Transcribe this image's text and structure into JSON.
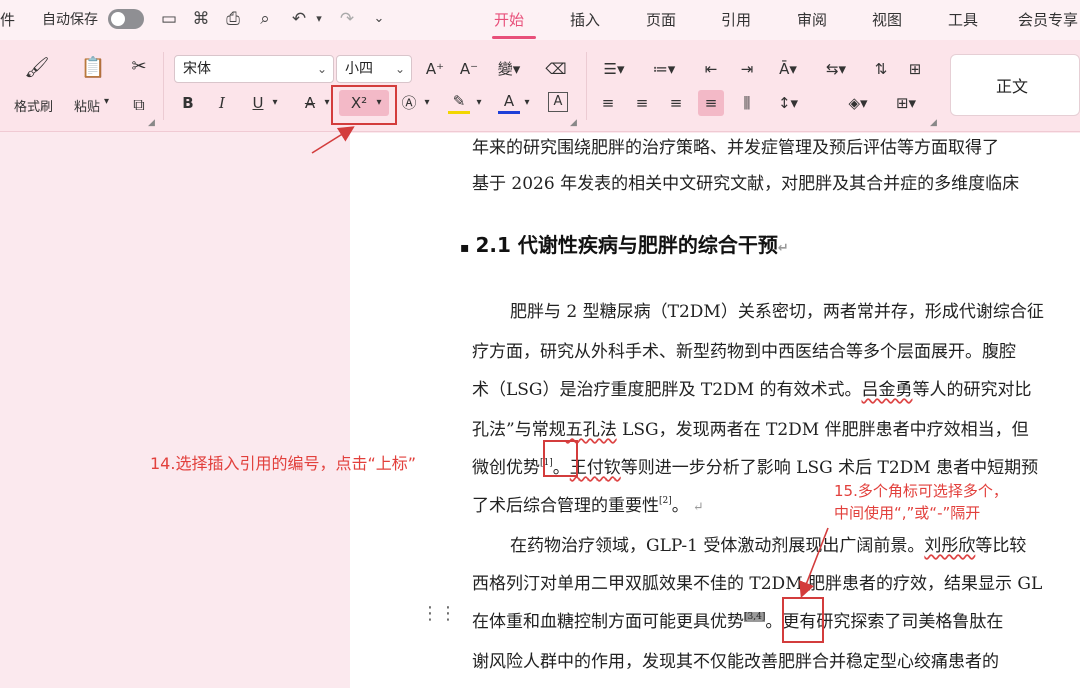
{
  "titlebar": {
    "left_fragment": "件",
    "autosave_label": "自动保存",
    "autosave_on": false
  },
  "menu": {
    "tabs": [
      "开始",
      "插入",
      "页面",
      "引用",
      "审阅",
      "视图",
      "工具",
      "会员专享"
    ],
    "active": "开始"
  },
  "ribbon": {
    "format_painter": "格式刷",
    "paste": "粘贴",
    "font_family": "宋体",
    "font_size": "小四",
    "bold": "B",
    "italic": "I",
    "underline": "U",
    "strike": "A",
    "superscript": "X²",
    "style_preview": "正文"
  },
  "document": {
    "line1": "年来的研究围绕肥胖的治疗策略、并发症管理及预后评估等方面取得了",
    "line2": "基于 2026 年发表的相关中文研究文献，对肥胖及其合并症的多维度临床",
    "heading": "2.1 代谢性疾病与肥胖的综合干预",
    "p1_l1": "肥胖与 2 型糖尿病（T2DM）关系密切，两者常并存，形成代谢综合征",
    "p1_l2": "疗方面，研究从外科手术、新型药物到中西医结合等多个层面展开。腹腔",
    "p1_l3a": "术（LSG）是治疗重度肥胖及 T2DM 的有效术式。",
    "p1_l3b": "吕金勇",
    "p1_l3c": "等人的研究对比",
    "p1_l4a": "孔法”与常规",
    "p1_l4b": "五孔法",
    "p1_l4c": " LSG，发现两者在 T2DM 伴肥胖患者中疗效相当，但",
    "p1_l5a": "微创优势",
    "p1_l5_cite": "[1]",
    "p1_l5b": "。",
    "p1_l5c": "王付钦",
    "p1_l5d": "等则进一步分析了影响 LSG 术后 T2DM 患者中短期预",
    "p1_l6a": "了术后综合管理的重要性",
    "p1_l6_cite": "[2]",
    "p1_l6b": "。",
    "p2_l1a": "在药物治疗领域，GLP-1 受体激动剂展现出广阔前景。",
    "p2_l1b": "刘彤欣",
    "p2_l1c": "等比较",
    "p2_l2a": "西格列汀对单用二甲双胍效果不佳的 T2DM 肥胖患者的疗效，结果显示 GL",
    "p2_l3a": "在体重和血糖控制方面可能更具优势",
    "p2_l3_sel": "[3,4]",
    "p2_l3b": "。更有研究探索了司美格鲁肽在",
    "p2_l4a": "谢风险人群中的作用，发现其不仅能改善肥胖合并稳定型心绞痛患者的"
  },
  "annotations": {
    "step14": "14.选择插入引用的编号，点击“上标”",
    "step15_l1": "15.多个角标可选择多个，",
    "step15_l2": "中间使用“,”或“-”隔开"
  },
  "colors": {
    "accent": "#e8507a",
    "annotation": "#e2403c"
  }
}
